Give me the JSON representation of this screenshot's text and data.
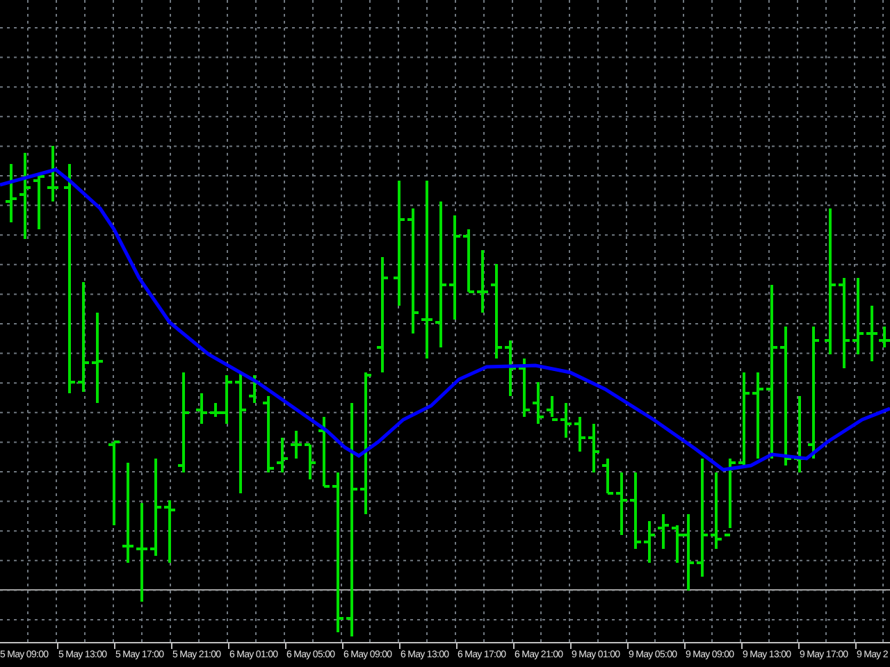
{
  "chart": {
    "x_axis_labels": [
      "5 May 09:00",
      "5 May 13:00",
      "5 May 17:00",
      "5 May 21:00",
      "6 May 01:00",
      "6 May 05:00",
      "6 May 09:00",
      "6 May 13:00",
      "6 May 17:00",
      "6 May 21:00",
      "9 May 01:00",
      "9 May 05:00",
      "9 May 09:00",
      "9 May 13:00",
      "9 May 17:00",
      "9 May 2"
    ]
  }
}
